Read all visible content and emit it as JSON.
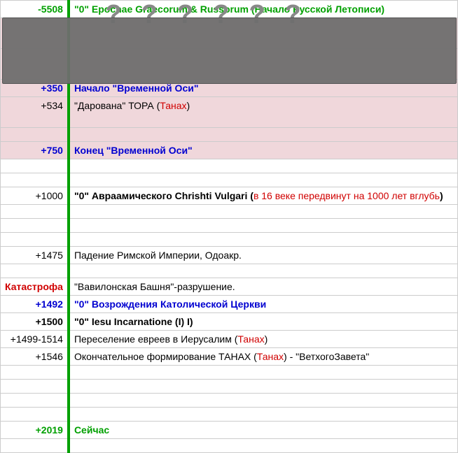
{
  "overlay": {
    "qmarks": "??????"
  },
  "rows": [
    {
      "y": "-5508",
      "ystyle": "green bold",
      "c": "\"0\" Epochae Graecorum & Russorum (Начало Русской Летописи)",
      "cstyle": "green bold",
      "bg": "",
      "height": ""
    },
    {
      "y": "",
      "ystyle": "",
      "c": "",
      "cstyle": "",
      "bg": "highlight",
      "height": "tall"
    },
    {
      "y": "",
      "ystyle": "",
      "c": "",
      "cstyle": "",
      "bg": "highlight",
      "height": "tall"
    },
    {
      "y": "+350",
      "ystyle": "blue bold",
      "c": "Начало \"Временной Оси\"",
      "cstyle": "blue bold",
      "bg": "highlight",
      "height": ""
    },
    {
      "y": "+534",
      "ystyle": "normal",
      "c": "\"Дарована\" ТОРА (",
      "suffix": "Танах",
      "suffixstyle": "redthin",
      "tail": ")",
      "bg": "highlight",
      "height": "tall"
    },
    {
      "y": "",
      "ystyle": "",
      "c": "",
      "cstyle": "",
      "bg": "highlight",
      "height": "short"
    },
    {
      "y": "+750",
      "ystyle": "blue bold",
      "c": "Конец \"Временной Оси\"",
      "cstyle": "blue bold",
      "bg": "highlight",
      "height": ""
    },
    {
      "y": "",
      "ystyle": "",
      "c": "",
      "cstyle": "",
      "bg": "",
      "height": "short"
    },
    {
      "y": "",
      "ystyle": "",
      "c": "",
      "cstyle": "",
      "bg": "",
      "height": "short"
    },
    {
      "y": "+1000",
      "ystyle": "normal",
      "c": "\"0\" Авраамического Chrishti Vulgari (",
      "cstyle": "bold",
      "suffix": "в 16 веке передвинут на 1000 лет вглубь",
      "suffixstyle": "redthin",
      "tail": ")",
      "bg": "",
      "height": ""
    },
    {
      "y": "",
      "ystyle": "",
      "c": "",
      "cstyle": "",
      "bg": "",
      "height": "short"
    },
    {
      "y": "",
      "ystyle": "",
      "c": "",
      "cstyle": "",
      "bg": "",
      "height": "short"
    },
    {
      "y": "",
      "ystyle": "",
      "c": "",
      "cstyle": "",
      "bg": "",
      "height": "short"
    },
    {
      "y": "+1475",
      "ystyle": "normal",
      "c": "Падение Римской Империи, Одоакр.",
      "cstyle": "",
      "bg": "",
      "height": ""
    },
    {
      "y": "",
      "ystyle": "",
      "c": "",
      "cstyle": "",
      "bg": "",
      "height": "short"
    },
    {
      "y": "Катастрофа",
      "ystyle": "red bold",
      "c": "\"Вавилонская Башня\"-разрушение.",
      "cstyle": "",
      "bg": "",
      "height": ""
    },
    {
      "y": "+1492",
      "ystyle": "blue bold",
      "c": "\"0\" Возрождения Католической Церкви",
      "cstyle": "blue bold",
      "bg": "",
      "height": ""
    },
    {
      "y": "+1500",
      "ystyle": "bold",
      "c": "\"0\" Iesu Incarnatione (I) I)",
      "cstyle": "bold",
      "bg": "",
      "height": ""
    },
    {
      "y": "+1499-1514",
      "ystyle": "normal",
      "c": "Переселение евреев в Иерусалим (",
      "cstyle": "",
      "suffix": "Танах",
      "suffixstyle": "redthin",
      "tail": ")",
      "bg": "",
      "height": ""
    },
    {
      "y": "+1546",
      "ystyle": "normal",
      "c": "Окончательное формирование ТАНАХ (",
      "cstyle": "",
      "suffix": "Танах",
      "suffixstyle": "redthin",
      "tail": ") - \"ВетхогоЗавета\"",
      "bg": "",
      "height": ""
    },
    {
      "y": "",
      "ystyle": "",
      "c": "",
      "cstyle": "",
      "bg": "",
      "height": "short"
    },
    {
      "y": "",
      "ystyle": "",
      "c": "",
      "cstyle": "",
      "bg": "",
      "height": "short"
    },
    {
      "y": "",
      "ystyle": "",
      "c": "",
      "cstyle": "",
      "bg": "",
      "height": "short"
    },
    {
      "y": "",
      "ystyle": "",
      "c": "",
      "cstyle": "",
      "bg": "",
      "height": "short"
    },
    {
      "y": "+2019",
      "ystyle": "green bold",
      "c": "Сейчас",
      "cstyle": "green bold",
      "bg": "",
      "height": ""
    },
    {
      "y": "",
      "ystyle": "",
      "c": "",
      "cstyle": "",
      "bg": "",
      "height": "short"
    }
  ]
}
